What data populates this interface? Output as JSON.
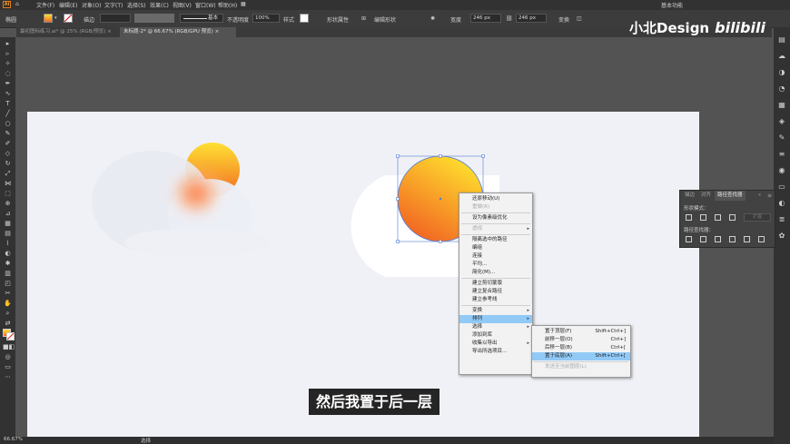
{
  "app": {
    "logo": "Ai",
    "workspace": "基本功能"
  },
  "menubar": {
    "items": [
      "文件(F)",
      "编辑(E)",
      "对象(O)",
      "文字(T)",
      "选择(S)",
      "效果(C)",
      "视图(V)",
      "窗口(W)",
      "帮助(H)"
    ]
  },
  "control_bar": {
    "left_label": "椭圆",
    "stroke_label": "描边",
    "brush_value": "基本",
    "opacity_label": "不透明度",
    "opacity_value": "100%",
    "style_label": "样式",
    "shape_label": "形状属性",
    "edit_label": "编辑形状",
    "width_label": "宽度",
    "width_value": "246 px",
    "height_value": "246 px",
    "transform_label": "变换"
  },
  "tabs": [
    {
      "label": "最初图标练习.ai* @ 25% (RGB/预览)",
      "active": false
    },
    {
      "label": "未标题-2* @ 66.67% (RGB/GPU 预览)",
      "active": true
    }
  ],
  "context_menu": {
    "items": [
      {
        "label": "还原移动(U)",
        "disabled": false
      },
      {
        "label": "重做(R)",
        "disabled": true
      },
      {
        "sep": true
      },
      {
        "label": "设为像素级优化",
        "disabled": false
      },
      {
        "sep": true
      },
      {
        "label": "透视",
        "disabled": true,
        "submenu": true
      },
      {
        "sep": true
      },
      {
        "label": "隔离选中的路径",
        "disabled": false
      },
      {
        "label": "编组",
        "disabled": false
      },
      {
        "label": "连接",
        "disabled": false
      },
      {
        "label": "平均...",
        "disabled": false
      },
      {
        "label": "简化(M)...",
        "disabled": false
      },
      {
        "sep": true
      },
      {
        "label": "建立剪切蒙版",
        "disabled": false
      },
      {
        "label": "建立复合路径",
        "disabled": false
      },
      {
        "label": "建立参考线",
        "disabled": false
      },
      {
        "sep": true
      },
      {
        "label": "变换",
        "disabled": false,
        "submenu": true
      },
      {
        "label": "排列",
        "disabled": false,
        "submenu": true,
        "highlighted": true
      },
      {
        "label": "选择",
        "disabled": false,
        "submenu": true
      },
      {
        "label": "添加到库",
        "disabled": false
      },
      {
        "label": "收集以导出",
        "disabled": false,
        "submenu": true
      },
      {
        "label": "导出所选项目...",
        "disabled": false
      }
    ]
  },
  "arrange_submenu": {
    "items": [
      {
        "label": "置于顶层(F)",
        "shortcut": "Shift+Ctrl+]"
      },
      {
        "label": "前移一层(O)",
        "shortcut": "Ctrl+]"
      },
      {
        "label": "后移一层(B)",
        "shortcut": "Ctrl+["
      },
      {
        "label": "置于底层(A)",
        "shortcut": "Shift+Ctrl+[",
        "highlighted": true
      },
      {
        "sep": true
      },
      {
        "label": "发送至当前图层(L)",
        "disabled": true
      }
    ]
  },
  "pathfinder_panel": {
    "tabs": [
      "描边",
      "对齐",
      "路径查找器"
    ],
    "active_tab": "路径查找器",
    "shape_modes_label": "形状模式：",
    "expand_label": "扩展",
    "pathfinders_label": "路径查找器："
  },
  "status_bar": {
    "zoom": "66.67%",
    "tool": "选择"
  },
  "subtitle": "然后我置于后一层",
  "watermark": {
    "text": "小北Design",
    "brand": "bilibili"
  },
  "colors": {
    "highlight": "#91c9f7",
    "sun_top": "#ffe032",
    "sun_bottom": "#f16a23",
    "artboard": "#f0f1f6",
    "ui_dark": "#323232"
  }
}
